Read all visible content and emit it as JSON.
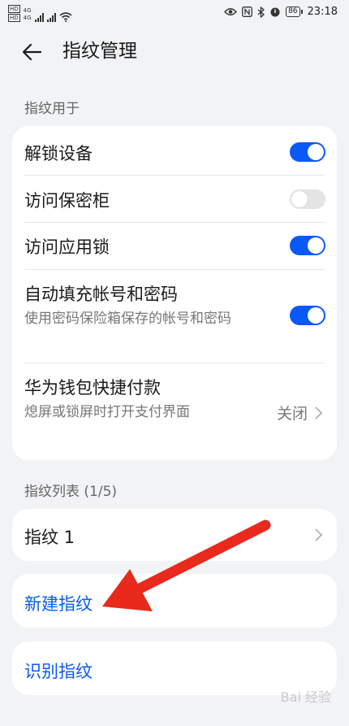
{
  "status": {
    "left_tags": [
      "HD",
      "4G",
      "HD",
      "4G"
    ],
    "time": "23:18",
    "battery": "86"
  },
  "header": {
    "title": "指纹管理"
  },
  "section_usage": "指纹用于",
  "settings": [
    {
      "title": "解锁设备",
      "toggle": "on"
    },
    {
      "title": "访问保密柜",
      "toggle": "off"
    },
    {
      "title": "访问应用锁",
      "toggle": "on"
    },
    {
      "title": "自动填充帐号和密码",
      "subtitle": "使用密码保险箱保存的帐号和密码",
      "toggle": "on"
    },
    {
      "title": "华为钱包快捷付款",
      "subtitle": "熄屏或锁屏时打开支付界面",
      "value": "关闭"
    }
  ],
  "section_list": "指纹列表 (1/5)",
  "fingerprints": [
    {
      "label": "指纹 1"
    }
  ],
  "actions": {
    "new": "新建指纹",
    "identify": "识别指纹"
  },
  "colors": {
    "accent": "#0a59f7",
    "annotation_arrow": "#e8291c"
  },
  "watermark": "Bai 经验"
}
